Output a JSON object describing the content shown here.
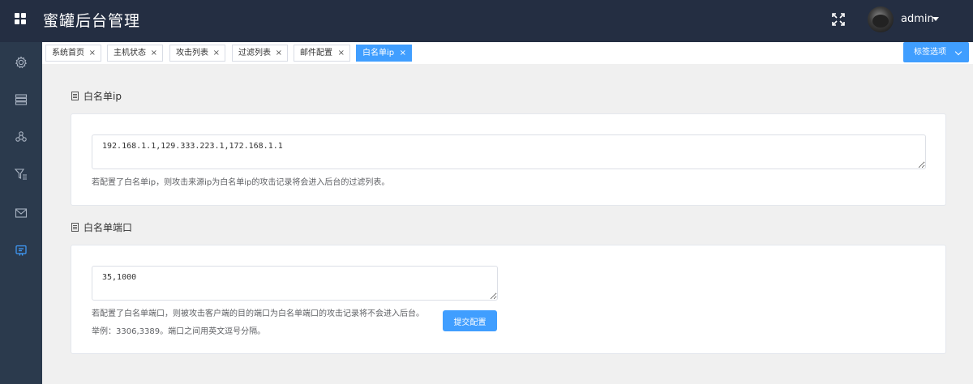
{
  "header": {
    "title": "蜜罐后台管理",
    "username": "admin",
    "icons": {
      "logo": "grid-icon",
      "fullscreen": "fullscreen-icon",
      "user_menu": "caret-down-icon"
    }
  },
  "sidebar": {
    "items": [
      {
        "icon": "settings-icon"
      },
      {
        "icon": "server-icon"
      },
      {
        "icon": "attack-icon"
      },
      {
        "icon": "filter-list-icon"
      },
      {
        "icon": "mail-icon"
      },
      {
        "icon": "whitelist-icon",
        "active": true
      }
    ]
  },
  "tags": {
    "items": [
      {
        "label": "系统首页",
        "active": false
      },
      {
        "label": "主机状态",
        "active": false
      },
      {
        "label": "攻击列表",
        "active": false
      },
      {
        "label": "过滤列表",
        "active": false
      },
      {
        "label": "邮件配置",
        "active": false
      },
      {
        "label": "白名单ip",
        "active": true
      }
    ],
    "close_symbol": "×",
    "options_label": "标签选项"
  },
  "whitelist_ip": {
    "heading": "白名单ip",
    "value": "192.168.1.1,129.333.223.1,172.168.1.1",
    "hint": "若配置了白名单ip，则攻击来源ip为白名单ip的攻击记录将会进入后台的过滤列表。"
  },
  "whitelist_port": {
    "heading": "白名单端口",
    "value": "35,1000",
    "hint": "若配置了白名单端口，则被攻击客户端的目的端口为白名单端口的攻击记录将不会进入后台。",
    "example": "举例：3306,3389。端口之间用英文逗号分隔。",
    "submit_label": "提交配置"
  },
  "colors": {
    "topbar": "#242e42",
    "sidebar": "#2b3a4d",
    "accent": "#409eff",
    "sidebar_icon": "#aab4c3"
  }
}
